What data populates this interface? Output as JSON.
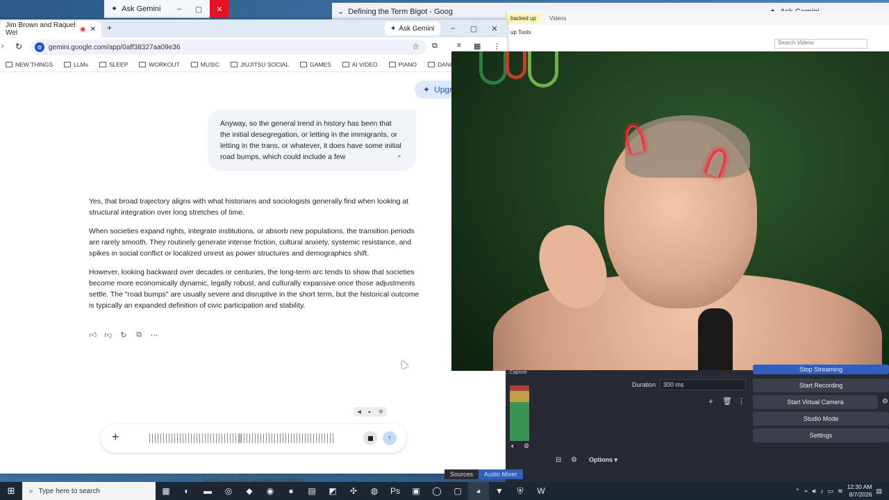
{
  "top_strip": {
    "left_tab_label": "Ask Gemini",
    "right_tab_label": "Defining the Term Bigot - Goog",
    "right_ask_label": "Ask Gemini"
  },
  "chrome": {
    "tab_title": "Jim Brown and Raquel Wel",
    "new_tab": "+",
    "ask_gemini_label": "Ask Gemini",
    "url": "gemini.google.com/app/0aff38327aa09e36",
    "bookmarks": [
      "NEW THINGS",
      "LLMs",
      "SLEEP",
      "WORKOUT",
      "MUSIC",
      "JIUJITSU SOCIAL",
      "GAMES",
      "AI VIDEO",
      "PIANO",
      "DANCE"
    ]
  },
  "gemini": {
    "upgrade_label": "Upgra",
    "user_message": "Anyway, so the general trend in history has been that the initial desegregation, or letting in the immigrants, or letting in the trans, or whatever, it does have some initial road bumps, which could include a few",
    "response_paragraphs": [
      "Yes, that broad trajectory aligns with what historians and sociologists generally find when looking at structural integration over long stretches of time.",
      "When societies expand rights, integrate institutions, or absorb new populations, the transition periods are rarely smooth. They routinely generate intense friction, cultural anxiety, systemic resistance, and spikes in social conflict or localized unrest as power structures and demographics shift.",
      "However, looking backward over decades or centuries, the long-term arc tends to show that societies become more economically dynamic, legally robust, and culturally expansive once those adjustments settle. The \"road bumps\" are usually severe and disruptive in the short term, but the historical outcome is typically an expanded definition of civic participation and stability."
    ],
    "disclaimer": "Gemini is AI and can make mistakes."
  },
  "explorer": {
    "tab_backup": "backed up",
    "tab_tools": "up Tools",
    "tab_videos": "Videos",
    "search_placeholder": "Search Videos"
  },
  "obs": {
    "source_label": "...Capture",
    "duration_label": "Duration",
    "duration_value": "300 ms",
    "stop_streaming": "Stop Streaming",
    "start_recording": "Start Recording",
    "start_virtual_camera": "Start Virtual Camera",
    "studio_mode": "Studio Mode",
    "settings": "Settings",
    "options": "Options",
    "tab_sources": "Sources",
    "tab_audio_mixer": "Audio Mixer",
    "colors": {
      "accent": "#2f5fbf",
      "panel": "#272a33"
    }
  },
  "taskbar": {
    "search_placeholder": "Type here to search",
    "time": "12:30 AM",
    "date": "8/7/2026"
  }
}
